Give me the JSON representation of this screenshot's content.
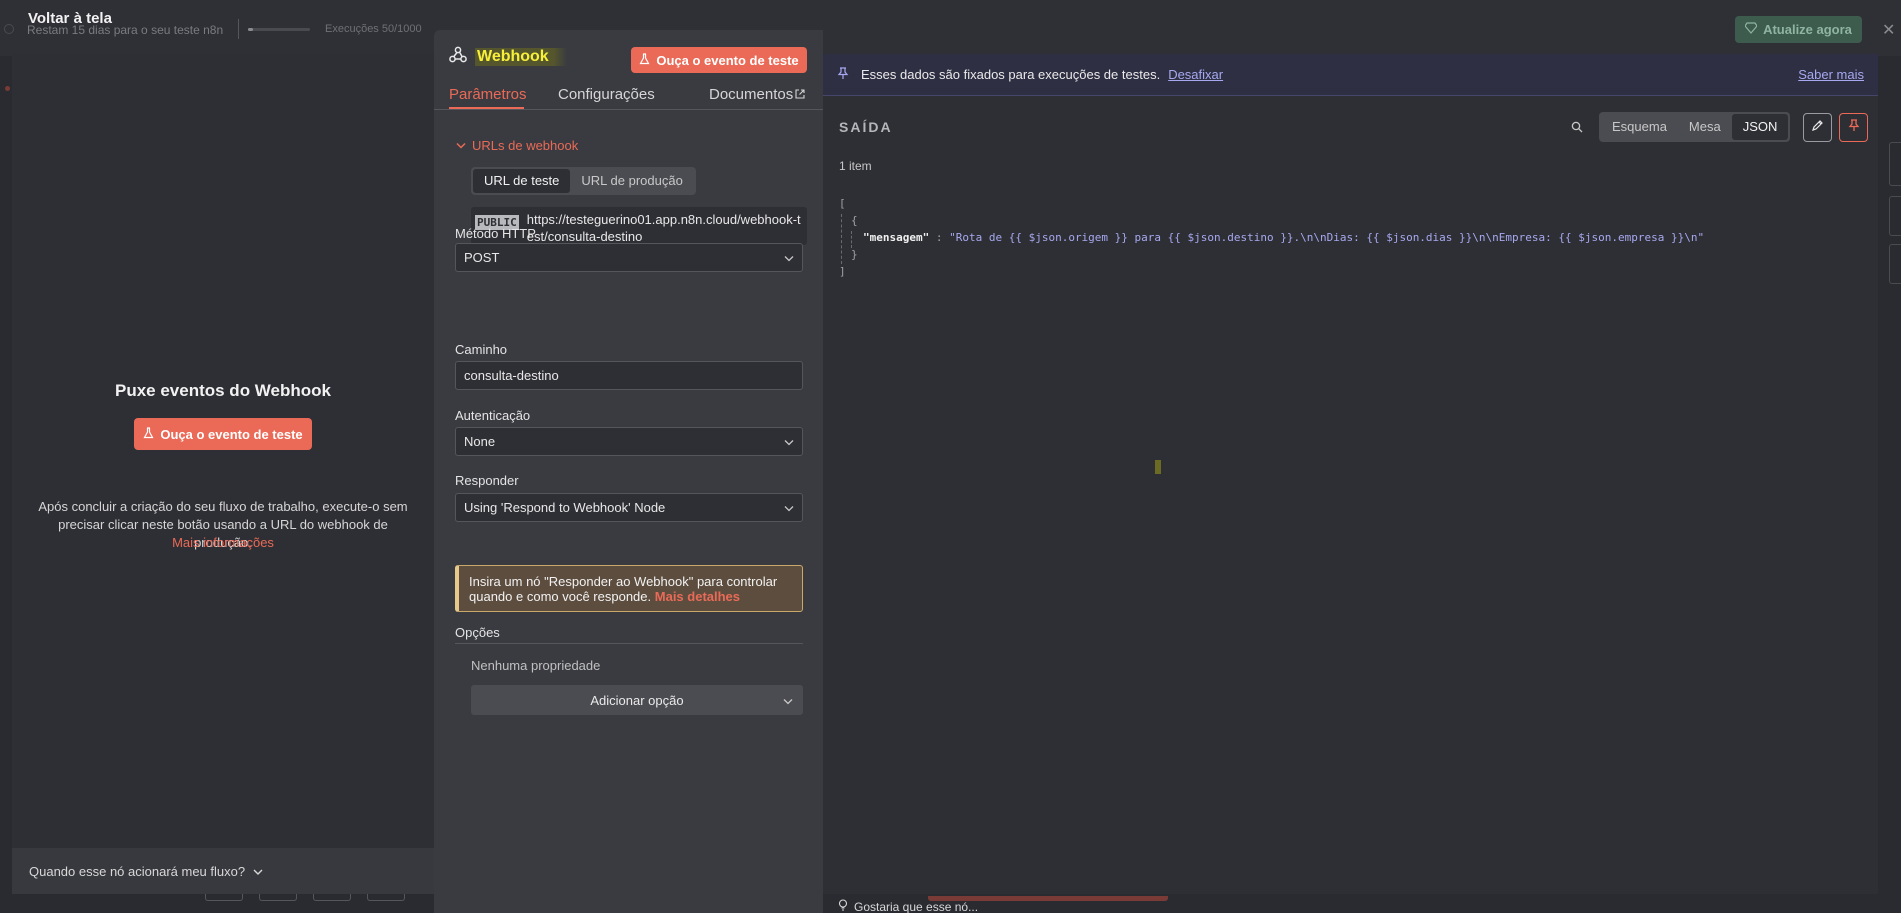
{
  "background": {
    "back_label": "Voltar à tela",
    "trial_text": "Restam 15 dias para o seu teste n8n",
    "executions_text": "Execuções 50/1000",
    "upgrade_label": "Atualize agora",
    "bottom_hint": "Gostaria que esse nó..."
  },
  "input_panel": {
    "title": "Puxe eventos do Webhook",
    "listen_label": "Ouça o evento de teste",
    "description": "Após concluir a criação do seu fluxo de trabalho, execute-o sem precisar clicar neste botão usando a URL do webhook de produção.",
    "more_info": "Mais informações",
    "footer_question": "Quando esse nó acionará meu fluxo?"
  },
  "node": {
    "title": "Webhook",
    "listen_label": "Ouça o evento de teste",
    "tabs": [
      {
        "label": "Parâmetros",
        "active": true
      },
      {
        "label": "Configurações",
        "active": false
      },
      {
        "label": "Documentos",
        "active": false
      }
    ],
    "webhook_urls_label": "URLs de webhook",
    "url_tabs": [
      {
        "label": "URL de teste",
        "active": true
      },
      {
        "label": "URL de produção",
        "active": false
      }
    ],
    "url_badge": "PUBLIC",
    "url_value": "https://testeguerino01.app.n8n.cloud/webhook-test/consulta-destino",
    "http_method_label": "Método HTTP",
    "http_method_value": "POST",
    "path_label": "Caminho",
    "path_value": "consulta-destino",
    "auth_label": "Autenticação",
    "auth_value": "None",
    "respond_label": "Responder",
    "respond_value": "Using 'Respond to Webhook' Node",
    "notice_text": "Insira um nó \"Responder ao Webhook\" para controlar quando e como você responde.",
    "notice_link": "Mais detalhes",
    "options_label": "Opções",
    "no_property": "Nenhuma propriedade",
    "add_option_label": "Adicionar opção"
  },
  "output": {
    "pinned_text": "Esses dados são fixados para execuções de testes.",
    "unpin_label": "Desafixar",
    "learn_more": "Saber mais",
    "title": "SAÍDA",
    "views": [
      {
        "label": "Esquema",
        "active": false
      },
      {
        "label": "Mesa",
        "active": false
      },
      {
        "label": "JSON",
        "active": true
      }
    ],
    "item_count": "1 item",
    "json": {
      "open_array": "[",
      "open_obj": "{",
      "key": "\"mensagem\"",
      "colon": " : ",
      "value": "\"Rota de {{ $json.origem }} para {{ $json.destino }}.\\n\\nDias: {{ $json.dias }}\\n\\nEmpresa: {{ $json.empresa }}\\n\"",
      "close_obj": "}",
      "close_array": "]"
    }
  },
  "colors": {
    "accent": "#ea6a57",
    "pinned_link": "#a7a8f0",
    "node_title": "#f7f03a"
  }
}
